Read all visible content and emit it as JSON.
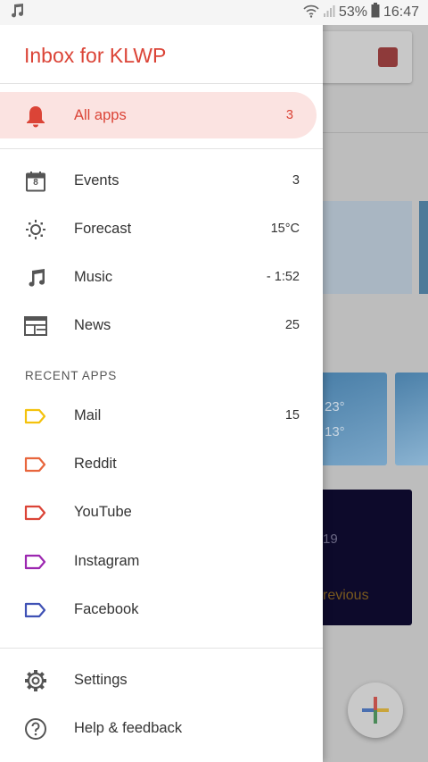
{
  "status_bar": {
    "music_icon": "music-note-icon",
    "battery_percent": "53%",
    "time": "16:47"
  },
  "background": {
    "temp_high": "23°",
    "temp_low": "13°",
    "number_fragment": "19",
    "previous_fragment": "revious"
  },
  "drawer": {
    "title": "Inbox for KLWP",
    "all_apps": {
      "label": "All apps",
      "count": "3",
      "icon": "bell-icon"
    },
    "items": [
      {
        "label": "Events",
        "count": "3",
        "icon": "calendar-icon",
        "calendar_day": "8"
      },
      {
        "label": "Forecast",
        "count": "15°C",
        "icon": "sun-icon"
      },
      {
        "label": "Music",
        "count": "- 1:52",
        "icon": "music-icon"
      },
      {
        "label": "News",
        "count": "25",
        "icon": "news-icon"
      }
    ],
    "recent_apps_title": "RECENT APPS",
    "recent_apps": [
      {
        "label": "Mail",
        "count": "15",
        "icon": "label-tag-icon",
        "color": "#f4c20d"
      },
      {
        "label": "Reddit",
        "count": "",
        "icon": "label-tag-icon",
        "color": "#e8663d"
      },
      {
        "label": "YouTube",
        "count": "",
        "icon": "label-tag-icon",
        "color": "#db4437"
      },
      {
        "label": "Instagram",
        "count": "",
        "icon": "label-tag-icon",
        "color": "#9c27b0"
      },
      {
        "label": "Facebook",
        "count": "",
        "icon": "label-tag-icon",
        "color": "#3f51b5"
      }
    ],
    "footer": [
      {
        "label": "Settings",
        "icon": "gear-icon"
      },
      {
        "label": "Help & feedback",
        "icon": "help-icon"
      }
    ]
  },
  "colors": {
    "accent": "#db4437",
    "active_bg": "#fbe3e1"
  }
}
